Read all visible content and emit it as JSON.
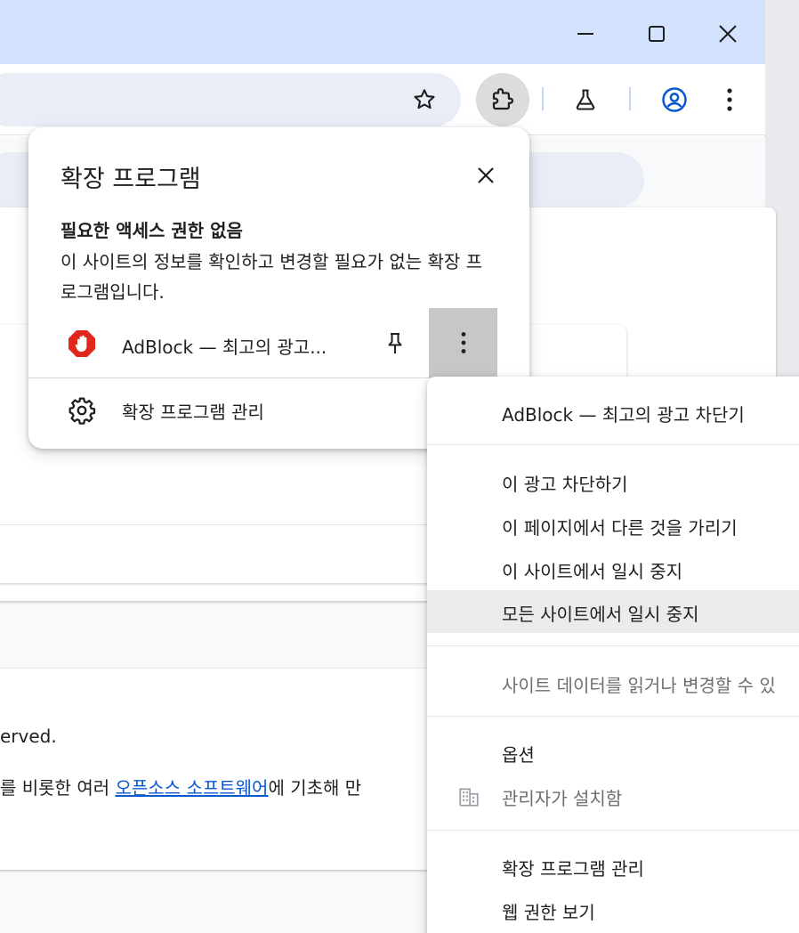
{
  "window": {
    "controls": {
      "minimize": "minimize-icon",
      "maximize": "maximize-icon",
      "close": "close-icon"
    }
  },
  "toolbar": {
    "icons": [
      "star-icon",
      "puzzle-icon",
      "flask-icon",
      "profile-icon",
      "kebab-icon"
    ]
  },
  "page": {
    "text_reserved": "erved.",
    "text_line_prefix": "를 비롯한 여러 ",
    "text_link": "오픈소스 소프트웨어",
    "text_line_suffix": "에 기초해 만"
  },
  "extensions_popup": {
    "title": "확장 프로그램",
    "section_heading": "필요한 액세스 권한 없음",
    "section_description": "이 사이트의 정보를 확인하고 변경할 필요가 없는 확장 프로그램입니다.",
    "extension": {
      "name": "AdBlock — 최고의 광고...",
      "icon": "adblock-icon",
      "color": "#e1261c"
    },
    "manage_label": "확장 프로그램 관리"
  },
  "context_menu": {
    "header": "AdBlock — 최고의 광고 차단기",
    "group1": [
      "이 광고 차단하기",
      "이 페이지에서 다른 것을 가리기",
      "이 사이트에서 일시 중지",
      "모든 사이트에서 일시 중지"
    ],
    "site_data": "사이트 데이터를 읽거나 변경할 수 있",
    "options": "옵션",
    "admin_installed": "관리자가 설치함",
    "manage": "확장 프로그램 관리",
    "web_permissions": "웹 권한 보기"
  },
  "colors": {
    "titlebar": "#d3e3fd",
    "omnibox": "#e9eef6",
    "accent": "#0b57d0",
    "hover": "#c7c7c7"
  }
}
